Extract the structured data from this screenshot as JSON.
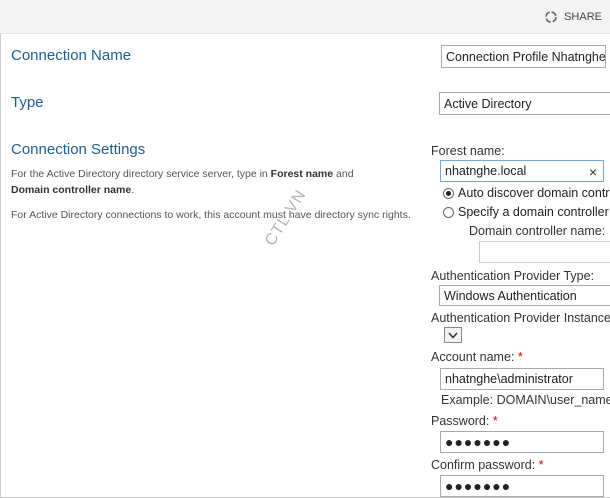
{
  "header": {
    "share_label": "SHARE"
  },
  "sections": {
    "connection_name": {
      "title": "Connection Name",
      "value": "Connection Profile Nhatnghe"
    },
    "type": {
      "title": "Type",
      "value": "Active Directory"
    },
    "connection_settings": {
      "title": "Connection Settings",
      "desc1_a": "For the Active Directory directory service server, type in ",
      "desc1_b": "Forest name",
      "desc1_c": " and",
      "desc1_d": "Domain controller name",
      "desc1_e": ".",
      "desc2": "For Active Directory connections to work, this account must have directory sync rights."
    }
  },
  "form": {
    "forest_label": "Forest name:",
    "forest_value": "nhatnghe.local",
    "clear_symbol": "×",
    "radio_auto": "Auto discover domain controller",
    "radio_specify": "Specify a domain controller",
    "dc_name_label": "Domain controller name:",
    "dc_name_value": "",
    "auth_type_label": "Authentication Provider Type:",
    "auth_type_value": "Windows Authentication",
    "auth_instance_label": "Authentication Provider Instance",
    "account_label": "Account name:",
    "account_value": "nhatnghe\\administrator",
    "account_example": "Example: DOMAIN\\user_name",
    "password_label": "Password:",
    "password_value": "●●●●●●●",
    "confirm_label": "Confirm password:",
    "confirm_value": "●●●●●●●",
    "required_marker": "*"
  },
  "watermark": "CTL.VN",
  "colors": {
    "title_blue": "#1f5d8f",
    "required_red": "#cc0000"
  },
  "icons": {
    "share": "share-icon",
    "dropdown": "chevron-down-icon",
    "clear": "close-icon"
  }
}
